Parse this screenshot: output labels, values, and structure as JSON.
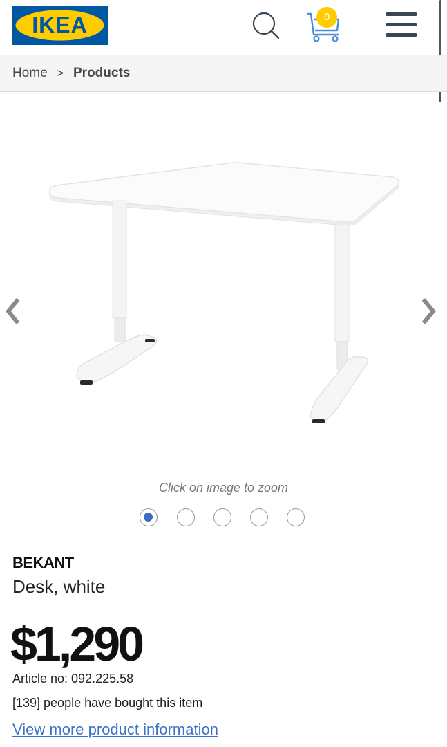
{
  "header": {
    "logo_text": "IKEA",
    "logo_icon": "ikea-logo",
    "search_icon": "search-icon",
    "cart_icon": "cart-icon",
    "cart_count": "0",
    "menu_icon": "hamburger-menu-icon",
    "colors": {
      "brand_blue": "#0058a3",
      "brand_yellow": "#ffcc00"
    }
  },
  "breadcrumb": {
    "home": "Home",
    "separator": ">",
    "current": "Products"
  },
  "gallery": {
    "prev_icon": "chevron-left-icon",
    "next_icon": "chevron-right-icon",
    "image_alt": "BEKANT desk, white",
    "zoom_hint": "Click on image to zoom",
    "slide_count": 5,
    "active_slide": 1,
    "active_color": "#3f6bbf"
  },
  "product": {
    "name": "BEKANT",
    "description": "Desk, white",
    "price": "$1,290",
    "article": "Article no: 092.225.58",
    "bought": "[139] people have bought this item",
    "more_link": "View more product information",
    "link_color": "#3a72c9"
  }
}
